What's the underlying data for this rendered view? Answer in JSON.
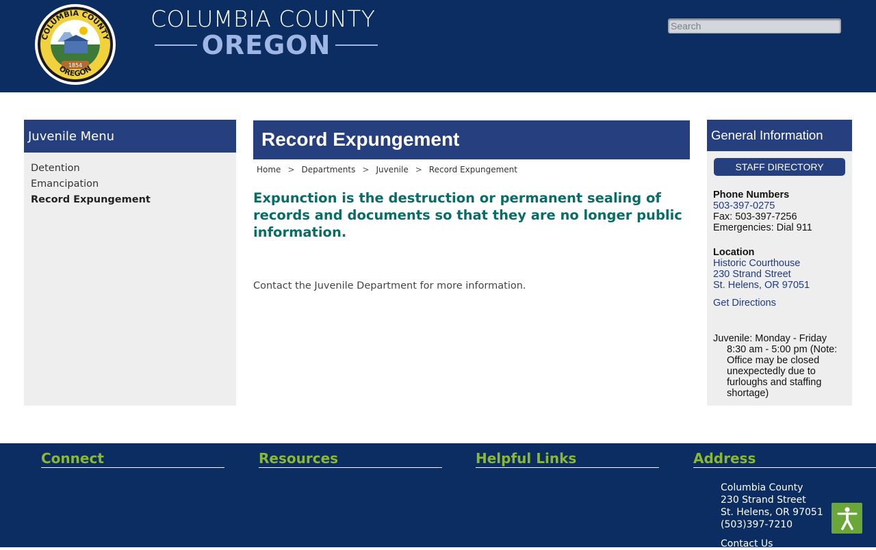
{
  "header": {
    "county_line1": "COLUMBIA COUNTY",
    "county_line2": "OREGON",
    "seal_text_top": "COLUMBIA COUNTY",
    "seal_text_bottom": "OREGON",
    "seal_year": "1854",
    "search_placeholder": "Search"
  },
  "left_menu": {
    "title": "Juvenile Menu",
    "items": [
      {
        "label": "Detention"
      },
      {
        "label": "Emancipation"
      },
      {
        "label": "Record Expungement"
      }
    ]
  },
  "main": {
    "title": "Record Expungement",
    "breadcrumb": [
      "Home",
      "Departments",
      "Juvenile",
      "Record Expungement"
    ],
    "lead": "Expunction is the destruction or permanent sealing of records and documents so that they are no longer public information.",
    "body": "Contact the Juvenile Department for more information."
  },
  "general_info": {
    "title": "General Information",
    "staff_button": "STAFF DIRECTORY",
    "phone_label": "Phone Numbers",
    "phone": "503-397-0275",
    "fax": "Fax: 503-397-7256",
    "emergency": "Emergencies: Dial 911",
    "location_label": "Location",
    "location_name": "Historic Courthouse",
    "street": "230 Strand Street",
    "city": "St. Helens, OR 97051",
    "directions": "Get Directions",
    "hours": "Juvenile: Monday - Friday 8:30 am - 5:00 pm (Note: Office may be closed unexpectedly due to furloughs and staffing shortage)"
  },
  "footer": {
    "connect": "Connect",
    "resources": "Resources",
    "helpful_links": "Helpful Links",
    "address_title": "Address",
    "address_name": "Columbia County",
    "address_street": "230 Strand Street",
    "address_city": "St. Helens, OR 97051",
    "address_phone": "(503)397-7210",
    "contact_us": "Contact Us"
  },
  "colors": {
    "header_navy": "#0c2d62",
    "panel_blue": "#263f7f",
    "lead_teal": "#0a6c67",
    "footer_green": "#8ab832",
    "accessibility_green": "#6aa738"
  }
}
